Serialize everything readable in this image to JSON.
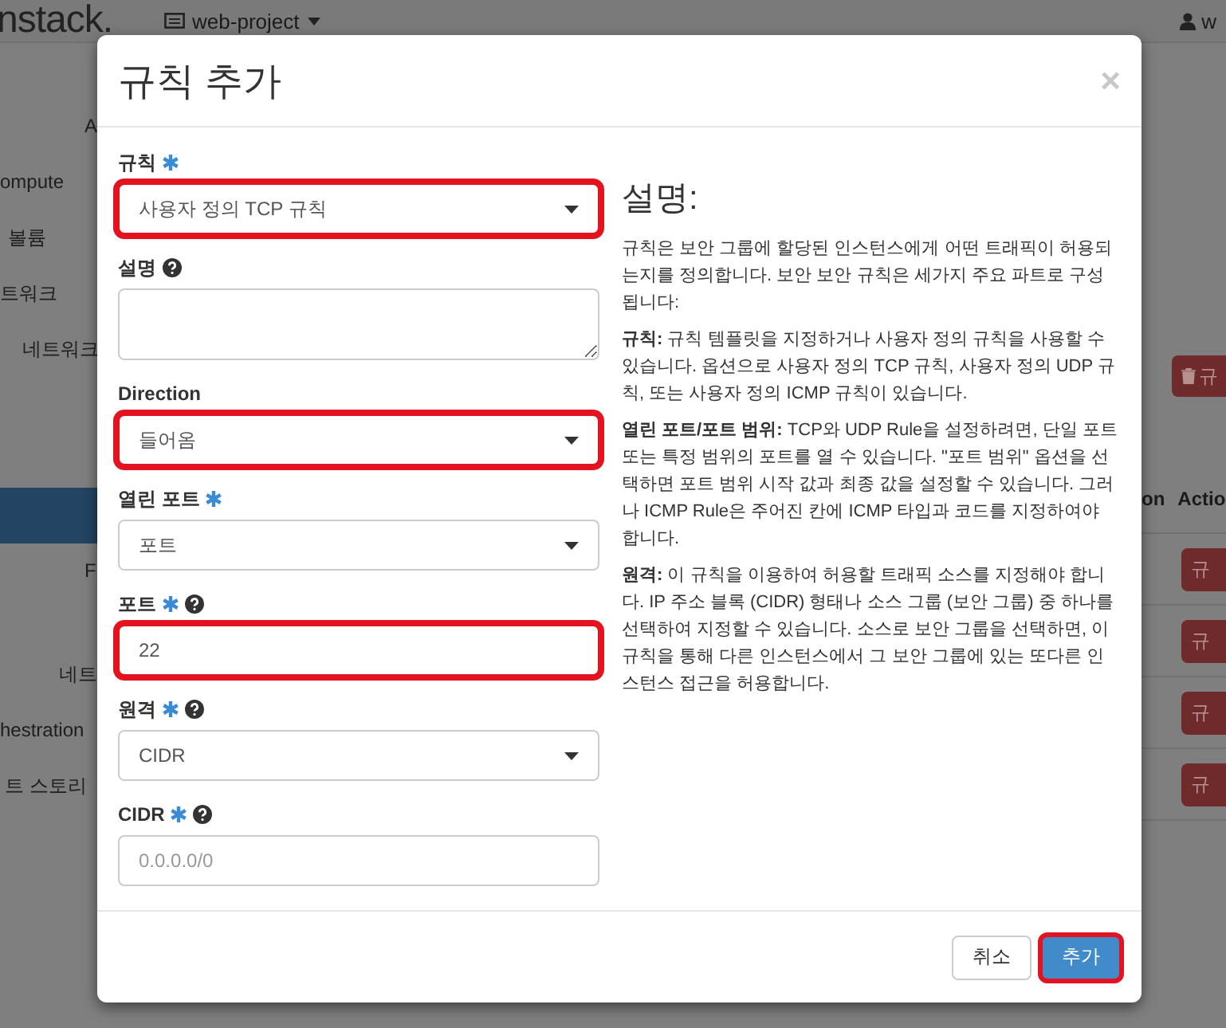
{
  "background": {
    "logo": "nstack.",
    "project": "web-project",
    "user": "w",
    "sidebar": [
      {
        "label": "A"
      },
      {
        "label": "ompute"
      },
      {
        "label": "볼륨"
      },
      {
        "label": "트워크"
      },
      {
        "label": "네트워크"
      },
      {
        "label": "F"
      },
      {
        "label": "네트"
      },
      {
        "label": "hestration"
      },
      {
        "label": "트 스토리"
      }
    ],
    "delete_button": "규",
    "table_headers": [
      "on",
      "Actio"
    ],
    "row_buttons": [
      "규",
      "규",
      "규",
      "규"
    ]
  },
  "dialog": {
    "title": "규칙 추가",
    "close": "×",
    "fields": [
      {
        "kind": "select",
        "label": "규칙",
        "required": true,
        "help": false,
        "value": "사용자 정의 TCP 규칙",
        "highlighted": true
      },
      {
        "kind": "textarea",
        "label": "설명",
        "required": false,
        "help": true,
        "highlighted": false
      },
      {
        "kind": "select",
        "label": "Direction",
        "required": false,
        "help": false,
        "value": "들어옴",
        "highlighted": true
      },
      {
        "kind": "select",
        "label": "열린 포트",
        "required": true,
        "help": false,
        "value": "포트",
        "highlighted": false
      },
      {
        "kind": "input",
        "label": "포트",
        "required": true,
        "help": true,
        "value": "22",
        "highlighted": true
      },
      {
        "kind": "select",
        "label": "원격",
        "required": true,
        "help": true,
        "value": "CIDR",
        "highlighted": false
      },
      {
        "kind": "input",
        "label": "CIDR",
        "required": true,
        "help": true,
        "placeholder": "0.0.0.0/0",
        "highlighted": false
      }
    ],
    "description": {
      "heading": "설명:",
      "paragraphs": [
        "규칙은 보안 그룹에 할당된 인스턴스에게 어떤 트래픽이 허용되는지를 정의합니다. 보안 보안 규칙은 세가지 주요 파트로 구성됩니다:",
        "**규칙:** 규칙 템플릿을 지정하거나 사용자 정의 규칙을 사용할 수 있습니다. 옵션으로 사용자 정의 TCP 규칙, 사용자 정의 UDP 규칙, 또는 사용자 정의 ICMP 규칙이 있습니다.",
        "**열린 포트/포트 범위:** TCP와 UDP Rule을 설정하려면, 단일 포트 또는 특정 범위의 포트를 열 수 있습니다. \"포트 범위\" 옵션을 선택하면 포트 범위 시작 값과 최종 값을 설정할 수 있습니다. 그러나 ICMP Rule은 주어진 칸에 ICMP 타입과 코드를 지정하여야 합니다.",
        "**원격:** 이 규칙을 이용하여 허용할 트래픽 소스를 지정해야 합니다. IP 주소 블록 (CIDR) 형태나 소스 그룹 (보안 그룹) 중 하나를 선택하여 지정할 수 있습니다. 소스로 보안 그룹을 선택하면, 이 규칙을 통해 다른 인스턴스에서 그 보안 그룹에 있는 또다른 인스턴스 접근을 허용합니다."
      ]
    },
    "buttons": [
      {
        "kind": "default",
        "label": "취소",
        "highlighted": false
      },
      {
        "kind": "primary",
        "label": "추가",
        "highlighted": true
      }
    ]
  }
}
